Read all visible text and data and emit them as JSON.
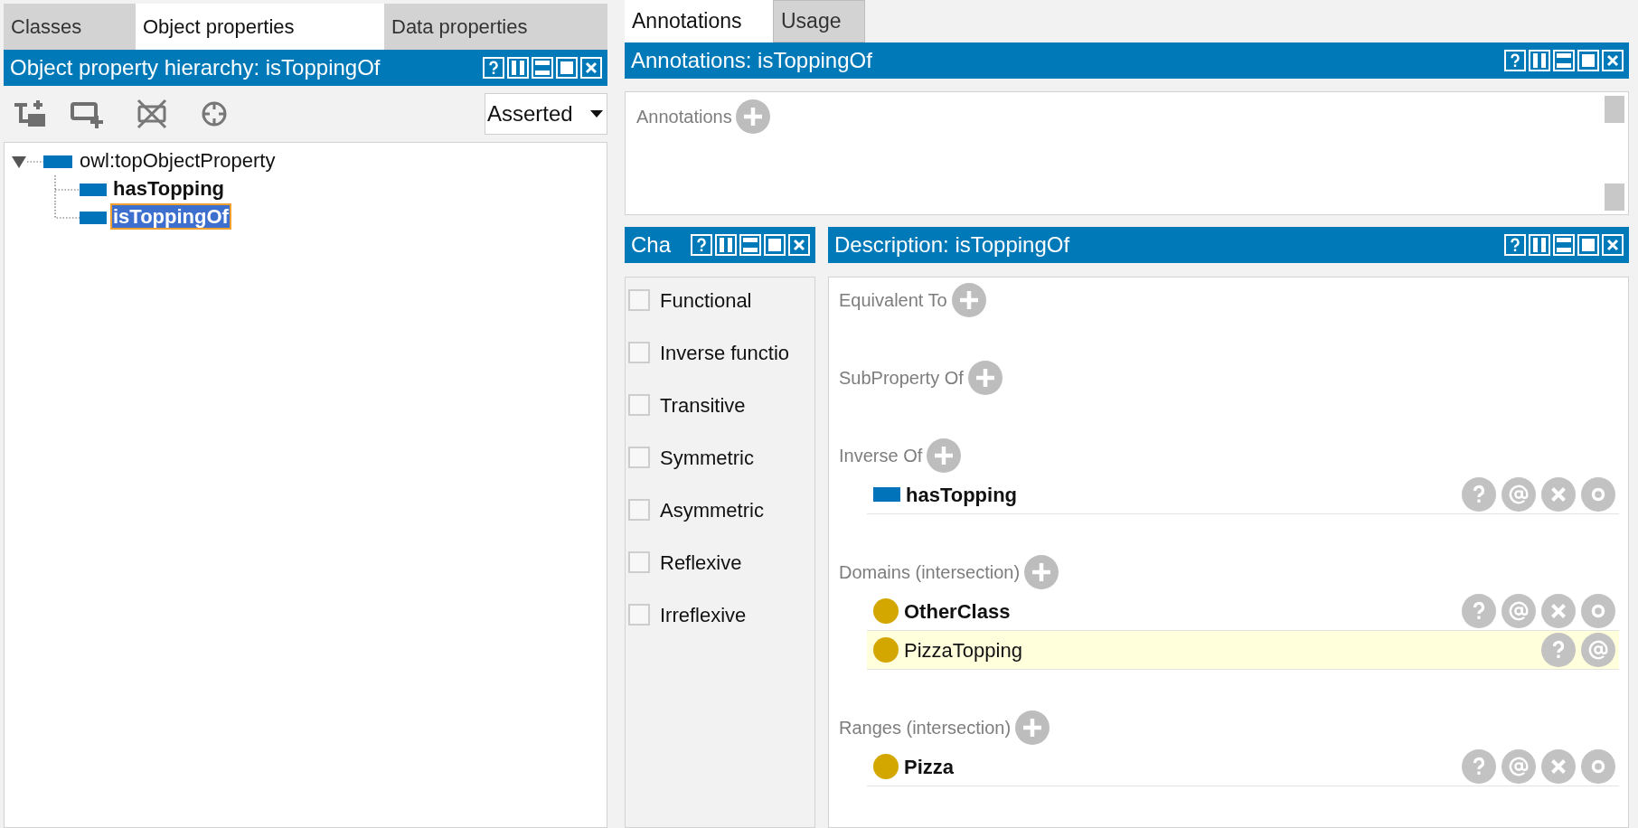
{
  "left_tabs": [
    {
      "label": "Classes",
      "selected": false
    },
    {
      "label": "Object properties",
      "selected": true
    },
    {
      "label": "Data properties",
      "selected": false
    }
  ],
  "hierarchy_panel": {
    "title": "Object property hierarchy: isToppingOf",
    "view_select": {
      "value": "Asserted"
    },
    "tree": [
      {
        "label": "owl:topObjectProperty",
        "bold": false,
        "selected": false,
        "expanded": true,
        "children": [
          {
            "label": "hasTopping",
            "bold": true,
            "selected": false
          },
          {
            "label": "isToppingOf",
            "bold": true,
            "selected": true
          }
        ]
      }
    ]
  },
  "right_tabs": [
    {
      "label": "Annotations",
      "selected": true
    },
    {
      "label": "Usage",
      "selected": false
    }
  ],
  "annotations_panel": {
    "title": "Annotations: isToppingOf",
    "section_label": "Annotations"
  },
  "characteristics_panel": {
    "title": "Cha",
    "items": [
      {
        "label": "Functional",
        "checked": false
      },
      {
        "label": "Inverse functio",
        "checked": false
      },
      {
        "label": "Transitive",
        "checked": false
      },
      {
        "label": "Symmetric",
        "checked": false
      },
      {
        "label": "Asymmetric",
        "checked": false
      },
      {
        "label": "Reflexive",
        "checked": false
      },
      {
        "label": "Irreflexive",
        "checked": false
      }
    ]
  },
  "description_panel": {
    "title": "Description: isToppingOf",
    "sections": [
      {
        "label": "Equivalent To"
      },
      {
        "label": "SubProperty Of"
      },
      {
        "label": "Inverse Of",
        "items": [
          {
            "kind": "property",
            "label": "hasTopping",
            "inferred": false
          }
        ]
      },
      {
        "label": "Domains (intersection)",
        "items": [
          {
            "kind": "class",
            "label": "OtherClass",
            "inferred": false
          },
          {
            "kind": "class",
            "label": "PizzaTopping",
            "inferred": true
          }
        ]
      },
      {
        "label": "Ranges (intersection)",
        "items": [
          {
            "kind": "class",
            "label": "Pizza",
            "inferred": false
          }
        ]
      }
    ]
  }
}
